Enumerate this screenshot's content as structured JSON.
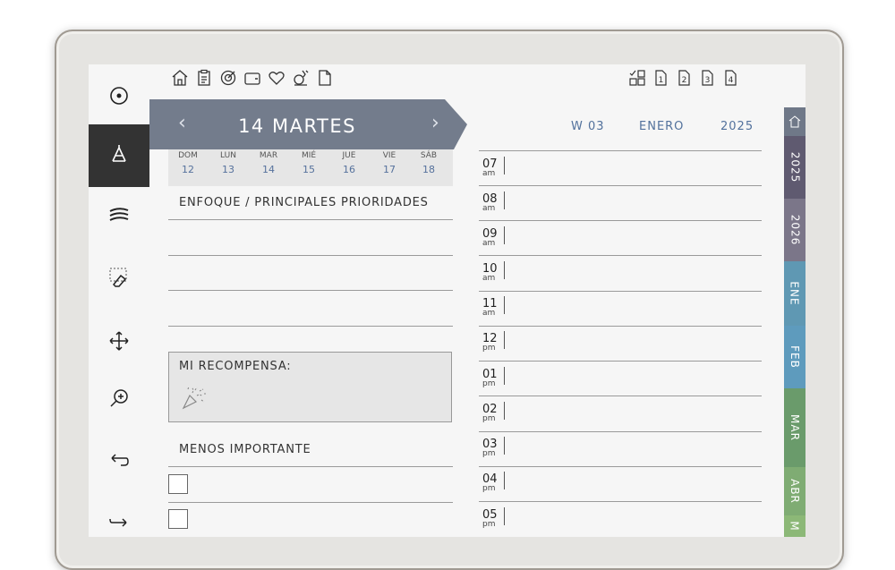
{
  "toolbar": {
    "icons": [
      "home-icon",
      "clipboard-icon",
      "target-icon",
      "wallet-icon",
      "heart-icon",
      "exercise-bike-icon",
      "document-icon"
    ],
    "right_icons": [
      "layout-icon",
      "page-1-icon",
      "page-2-icon",
      "page-3-icon",
      "page-4-icon"
    ],
    "page_numbers": [
      "1",
      "2",
      "3",
      "4"
    ]
  },
  "sidebar": {
    "tools": [
      "record-icon",
      "pen-icon",
      "lines-icon",
      "eraser-icon",
      "move-icon",
      "zoom-in-icon",
      "undo-icon",
      "redo-icon"
    ],
    "active_index": 1
  },
  "header": {
    "date_title": "14 MARTES",
    "week": "W 03",
    "month": "ENERO",
    "year": "2025"
  },
  "week_days": [
    {
      "name": "DOM",
      "num": "12"
    },
    {
      "name": "LUN",
      "num": "13"
    },
    {
      "name": "MAR",
      "num": "14"
    },
    {
      "name": "MIÉ",
      "num": "15"
    },
    {
      "name": "JUE",
      "num": "16"
    },
    {
      "name": "VIE",
      "num": "17"
    },
    {
      "name": "SÁB",
      "num": "18"
    }
  ],
  "sections": {
    "focus_title": "ENFOQUE / PRINCIPALES PRIORIDADES",
    "reward_title": "MI RECOMPENSA:",
    "less_important_title": "MENOS IMPORTANTE"
  },
  "hours": [
    {
      "h": "07",
      "ap": "am"
    },
    {
      "h": "08",
      "ap": "am"
    },
    {
      "h": "09",
      "ap": "am"
    },
    {
      "h": "10",
      "ap": "am"
    },
    {
      "h": "11",
      "ap": "am"
    },
    {
      "h": "12",
      "ap": "pm"
    },
    {
      "h": "01",
      "ap": "pm"
    },
    {
      "h": "02",
      "ap": "pm"
    },
    {
      "h": "03",
      "ap": "pm"
    },
    {
      "h": "04",
      "ap": "pm"
    },
    {
      "h": "05",
      "ap": "pm"
    }
  ],
  "side_tabs": [
    {
      "label": "home-icon",
      "color": "#6f7888"
    },
    {
      "label": "2025",
      "color": "#5f5a70"
    },
    {
      "label": "2026",
      "color": "#7b7689"
    },
    {
      "label": "ENE",
      "color": "#5f98b3"
    },
    {
      "label": "FEB",
      "color": "#5e9bbd"
    },
    {
      "label": "MAR",
      "color": "#6a9b6b"
    },
    {
      "label": "ABR",
      "color": "#7fac73"
    },
    {
      "label": "M",
      "color": "#8cb877"
    }
  ],
  "colors": {
    "ribbon": "#737c8c",
    "accent_blue": "#52719c",
    "sidebar_active": "#333333"
  }
}
